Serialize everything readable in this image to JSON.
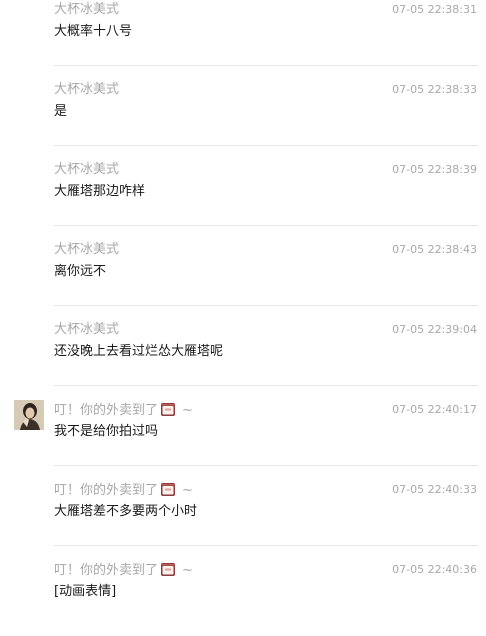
{
  "messages": [
    {
      "sender": "大杯冰美式",
      "time": "07-05 22:38:31",
      "text": "大概率十八号",
      "avatar": false
    },
    {
      "sender": "大杯冰美式",
      "time": "07-05 22:38:33",
      "text": "是",
      "avatar": false
    },
    {
      "sender": "大杯冰美式",
      "time": "07-05 22:38:39",
      "text": "大雁塔那边咋样",
      "avatar": false
    },
    {
      "sender": "大杯冰美式",
      "time": "07-05 22:38:43",
      "text": "离你远不",
      "avatar": false
    },
    {
      "sender": "大杯冰美式",
      "time": "07-05 22:39:04",
      "text": "还没晚上去看过烂怂大雁塔呢",
      "avatar": false
    },
    {
      "sender": "叮！你的外卖到了",
      "sender_suffix": "~",
      "sender_icon": "takeout-box-icon",
      "time": "07-05 22:40:17",
      "text": "我不是给你拍过吗",
      "avatar": true
    },
    {
      "sender": "叮！你的外卖到了",
      "sender_suffix": "~",
      "sender_icon": "takeout-box-icon",
      "time": "07-05 22:40:33",
      "text": "大雁塔差不多要两个小时",
      "avatar": false
    },
    {
      "sender": "叮！你的外卖到了",
      "sender_suffix": "~",
      "sender_icon": "takeout-box-icon",
      "time": "07-05 22:40:36",
      "text": "[动画表情]",
      "avatar": false
    }
  ]
}
